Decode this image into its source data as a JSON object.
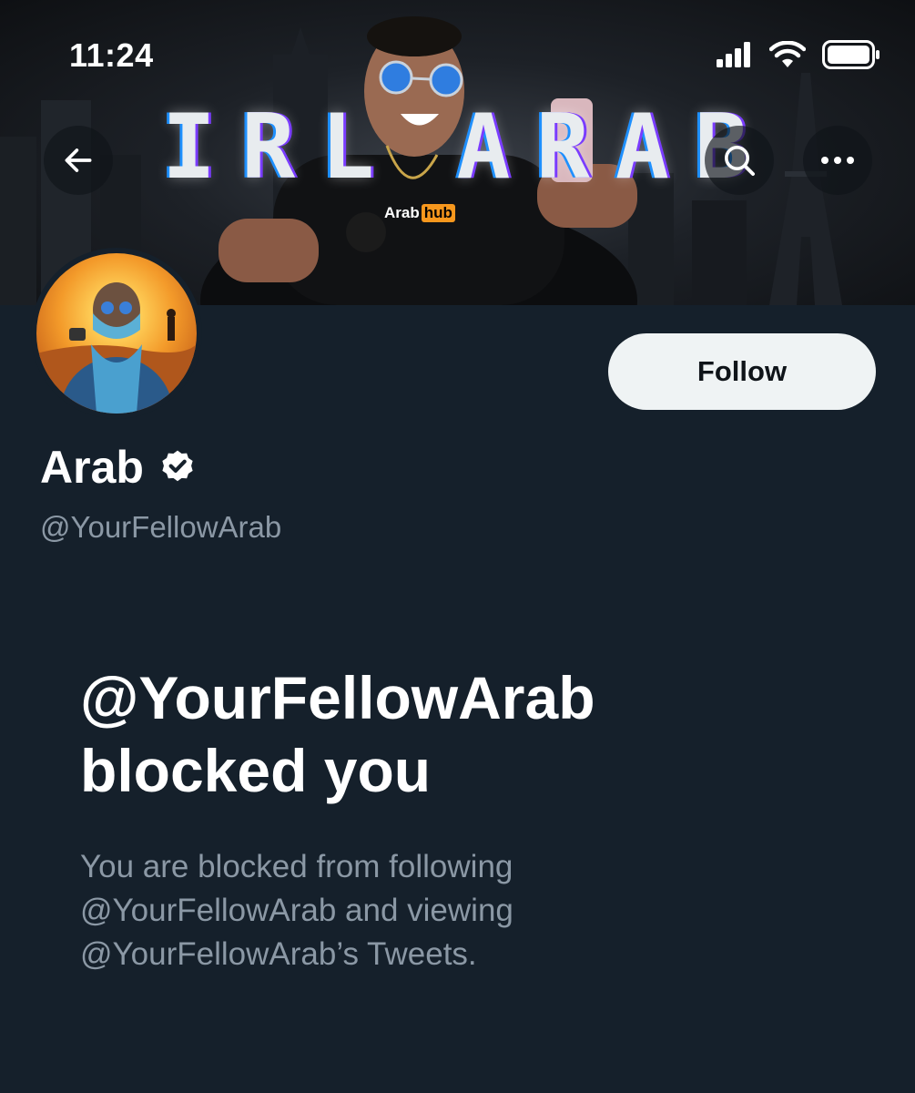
{
  "status_bar": {
    "time": "11:24",
    "icons": [
      "cellular-signal-icon",
      "wifi-icon",
      "battery-icon"
    ]
  },
  "banner": {
    "title_letters": [
      "I",
      "R",
      "L",
      " ",
      "A",
      "R",
      "A",
      "B"
    ],
    "shirt_logo": {
      "left": "Arab",
      "right": "hub"
    }
  },
  "nav": {
    "back_icon": "arrow-left-icon",
    "search_icon": "search-icon",
    "more_icon": "more-horizontal-icon"
  },
  "profile": {
    "name": "Arab",
    "verified": true,
    "handle": "@YourFellowArab",
    "follow_label": "Follow"
  },
  "blocked": {
    "title_line1": "@YourFellowArab",
    "title_line2": "blocked you",
    "desc_line1": "You are blocked from following",
    "desc_line2": "@YourFellowArab and viewing",
    "desc_line3": "@YourFellowArab’s Tweets."
  },
  "colors": {
    "background": "#15202b",
    "primary_text": "#ffffff",
    "secondary_text": "#8b98a5",
    "follow_button_bg": "#eff3f4",
    "follow_button_text": "#0f1419"
  }
}
